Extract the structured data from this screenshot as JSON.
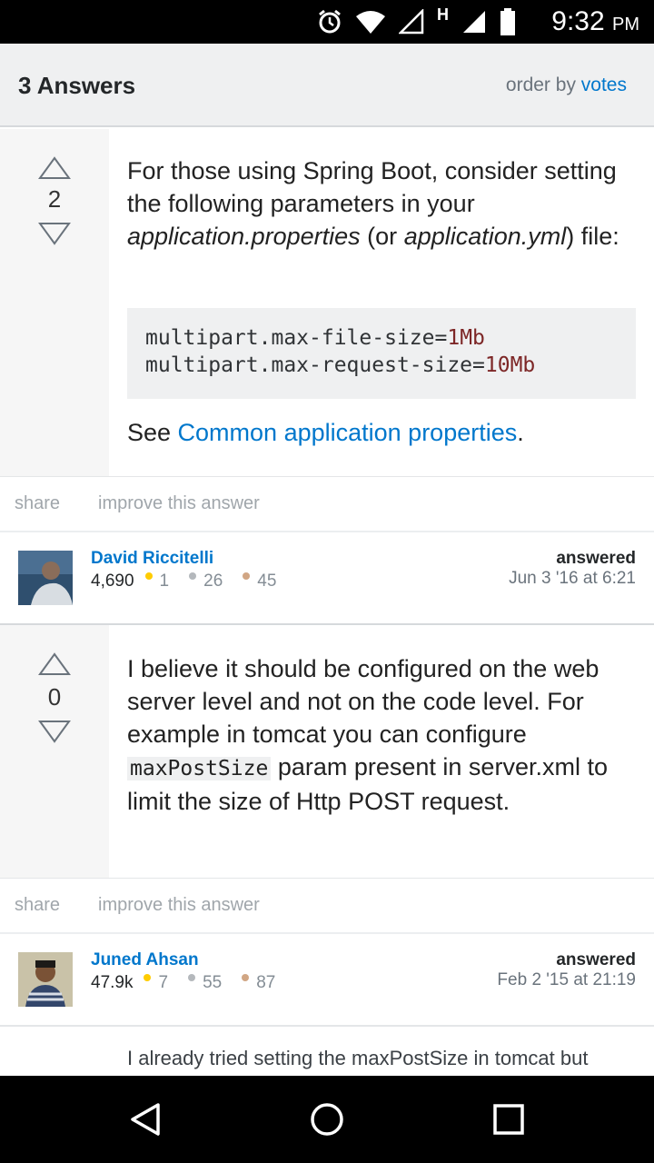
{
  "status_bar": {
    "time": "9:32",
    "ampm": "PM",
    "icons": [
      "alarm-icon",
      "wifi-icon",
      "signal-empty-icon",
      "h-network-icon",
      "signal-icon",
      "battery-icon"
    ],
    "network_label": "H"
  },
  "header": {
    "title": "3 Answers",
    "order_prefix": "order by",
    "order_value": "votes"
  },
  "answers": [
    {
      "votes": "2",
      "text_1": "For those using Spring Boot, consider setting the following parameters in your ",
      "text_em1": "application.properties",
      "text_2": " (or ",
      "text_em2": "application.yml",
      "text_3": ") file:",
      "code": [
        {
          "key": "multipart.max-file-size=",
          "val": "1Mb"
        },
        {
          "key": "multipart.max-request-size=",
          "val": "10Mb"
        }
      ],
      "see_prefix": "See ",
      "see_link": "Common application properties",
      "see_suffix": ".",
      "share": "share",
      "improve": "improve this answer",
      "user": {
        "name": "David Riccitelli",
        "rep": "4,690",
        "gold": "1",
        "silver": "26",
        "bronze": "45"
      },
      "answered_label": "answered",
      "answered_date": "Jun 3 '16 at 6:21"
    },
    {
      "votes": "0",
      "text_1": "I believe it should be configured on the web server level and not on the code level. For example in tomcat you can configure ",
      "code_inline": "maxPostSize",
      "text_2": " param present in server.xml to limit the size of Http POST request.",
      "share": "share",
      "improve": "improve this answer",
      "user": {
        "name": "Juned Ahsan",
        "rep": "47.9k",
        "gold": "7",
        "silver": "55",
        "bronze": "87"
      },
      "answered_label": "answered",
      "answered_date": "Feb 2 '15 at 21:19"
    }
  ],
  "comment_preview": "I already tried setting the maxPostSize in tomcat but",
  "colors": {
    "link": "#0077cc",
    "gold": "#ffcc01",
    "silver": "#b4b8bc",
    "bronze": "#d1a684",
    "code_value": "#7d2727"
  },
  "nav": [
    "back-icon",
    "home-icon",
    "recents-icon"
  ]
}
